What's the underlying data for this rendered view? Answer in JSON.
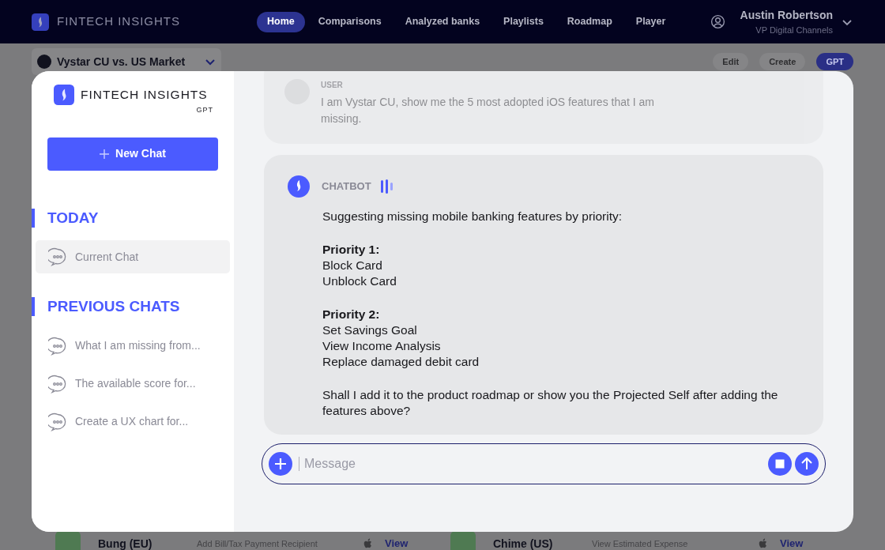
{
  "header": {
    "brand": "FINTECH INSIGHTS",
    "nav": [
      {
        "label": "Home",
        "selected": true
      },
      {
        "label": "Comparisons",
        "selected": false
      },
      {
        "label": "Analyzed banks",
        "selected": false
      },
      {
        "label": "Playlists",
        "selected": false
      },
      {
        "label": "Roadmap",
        "selected": false
      },
      {
        "label": "Player",
        "selected": false
      }
    ],
    "user": {
      "name": "Austin Robertson",
      "role": "VP Digital Channels"
    }
  },
  "background": {
    "selector": "Vystar CU vs. US Market",
    "buttons": [
      "Edit",
      "Create",
      "GPT"
    ],
    "rows": [
      {
        "bank": "Bung (EU)",
        "feature": "Add Bill/Tax Payment Recipient",
        "action": "View"
      },
      {
        "bank": "Chime (US)",
        "feature": "View Estimated Expense",
        "action": "View"
      }
    ]
  },
  "modal": {
    "sidebar": {
      "brand": "FINTECH INSIGHTS",
      "brand_sub": "GPT",
      "new_chat": "New Chat",
      "sections": [
        {
          "title": "TODAY",
          "items": [
            {
              "label": "Current Chat",
              "selected": true
            }
          ]
        },
        {
          "title": "PREVIOUS CHATS",
          "items": [
            {
              "label": "What I am missing from...",
              "selected": false
            },
            {
              "label": "The available score for...",
              "selected": false
            },
            {
              "label": "Create a UX chart for...",
              "selected": false
            }
          ]
        }
      ]
    },
    "messages": [
      {
        "kind": "user",
        "author": "USER",
        "text": "I am Vystar CU, show me the 5 most adopted iOS features that I am missing."
      },
      {
        "kind": "bot",
        "author": "CHATBOT",
        "intro": "Suggesting missing mobile banking features by priority:",
        "groups": [
          {
            "title": "Priority 1:",
            "items": [
              "Block Card",
              "Unblock Card"
            ]
          },
          {
            "title": "Priority 2:",
            "items": [
              "Set Savings Goal",
              "View Income Analysis",
              "Replace damaged debit card"
            ]
          }
        ],
        "closing": "Shall I add it to the product roadmap or show you the Projected Self after adding the features above?"
      }
    ],
    "composer": {
      "placeholder": "Message"
    }
  }
}
